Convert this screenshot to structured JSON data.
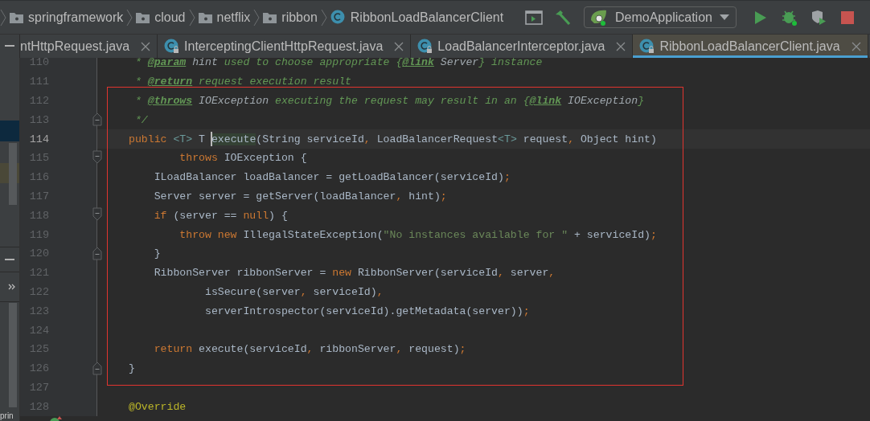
{
  "breadcrumbs": [
    {
      "kind": "folder",
      "label": "springframework"
    },
    {
      "kind": "folder",
      "label": "cloud"
    },
    {
      "kind": "folder",
      "label": "netflix"
    },
    {
      "kind": "folder",
      "label": "ribbon"
    },
    {
      "kind": "class",
      "label": "RibbonLoadBalancerClient"
    }
  ],
  "toolbar": {
    "run_config": "DemoApplication"
  },
  "tabs": [
    {
      "label": "ntHttpRequest.java",
      "selected": false,
      "has_icon": false
    },
    {
      "label": "InterceptingClientHttpRequest.java",
      "selected": false,
      "has_icon": true
    },
    {
      "label": "LoadBalancerInterceptor.java",
      "selected": false,
      "has_icon": true
    },
    {
      "label": "RibbonLoadBalancerClient.java",
      "selected": true,
      "has_icon": true
    }
  ],
  "side_panel": {
    "bottom_text": "prin"
  },
  "editor": {
    "lines": [
      {
        "number": "110",
        "current": false,
        "tokens": [
          {
            "kind": "comment",
            "text": " * "
          },
          {
            "kind": "tag",
            "text": "@param"
          },
          {
            "kind": "ref",
            "text": " hint"
          },
          {
            "kind": "comment",
            "text": " used to choose appropriate {"
          },
          {
            "kind": "tag",
            "text": "@link"
          },
          {
            "kind": "ref",
            "text": " Server"
          },
          {
            "kind": "comment",
            "text": "} instance"
          }
        ]
      },
      {
        "number": "111",
        "current": false,
        "tokens": [
          {
            "kind": "comment",
            "text": " * "
          },
          {
            "kind": "tag",
            "text": "@return"
          },
          {
            "kind": "comment",
            "text": " request execution result"
          }
        ]
      },
      {
        "number": "112",
        "current": false,
        "tokens": [
          {
            "kind": "comment",
            "text": " * "
          },
          {
            "kind": "tag",
            "text": "@throws"
          },
          {
            "kind": "ref",
            "text": " IOException"
          },
          {
            "kind": "comment",
            "text": " executing the request may result in an {"
          },
          {
            "kind": "tag",
            "text": "@link"
          },
          {
            "kind": "ref",
            "text": " IOException"
          },
          {
            "kind": "comment",
            "text": "}"
          }
        ]
      },
      {
        "number": "113",
        "current": false,
        "fold": {
          "kind": "end"
        },
        "tokens": [
          {
            "kind": "comment",
            "text": " */"
          }
        ]
      },
      {
        "number": "114",
        "current": true,
        "tokens": [
          {
            "kind": "keyword",
            "text": "public "
          },
          {
            "kind": "typeparam",
            "text": "<T>"
          },
          {
            "kind": "plain",
            "text": " T "
          },
          {
            "kind": "match",
            "text": "execute"
          },
          {
            "kind": "plain",
            "text": "(String serviceId"
          },
          {
            "kind": "punct",
            "text": ","
          },
          {
            "kind": "plain",
            "text": " LoadBalancerRequest"
          },
          {
            "kind": "typeparam",
            "text": "<T>"
          },
          {
            "kind": "plain",
            "text": " request"
          },
          {
            "kind": "punct",
            "text": ","
          },
          {
            "kind": "plain",
            "text": " Object hint)"
          }
        ]
      },
      {
        "number": "115",
        "current": false,
        "fold": {
          "kind": "start"
        },
        "tokens": [
          {
            "kind": "keyword",
            "text": "        throws"
          },
          {
            "kind": "plain",
            "text": " IOException {"
          }
        ]
      },
      {
        "number": "116",
        "current": false,
        "tokens": [
          {
            "kind": "plain",
            "text": "    ILoadBalancer loadBalancer = getLoadBalancer(serviceId)"
          },
          {
            "kind": "punct",
            "text": ";"
          }
        ]
      },
      {
        "number": "117",
        "current": false,
        "tokens": [
          {
            "kind": "plain",
            "text": "    Server server = getServer(loadBalancer"
          },
          {
            "kind": "punct",
            "text": ","
          },
          {
            "kind": "plain",
            "text": " hint)"
          },
          {
            "kind": "punct",
            "text": ";"
          }
        ]
      },
      {
        "number": "118",
        "current": false,
        "fold": {
          "kind": "start"
        },
        "tokens": [
          {
            "kind": "keyword",
            "text": "    if"
          },
          {
            "kind": "plain",
            "text": " (server == "
          },
          {
            "kind": "keyword",
            "text": "null"
          },
          {
            "kind": "plain",
            "text": ") {"
          }
        ]
      },
      {
        "number": "119",
        "current": false,
        "tokens": [
          {
            "kind": "keyword",
            "text": "        throw new"
          },
          {
            "kind": "plain",
            "text": " IllegalStateException("
          },
          {
            "kind": "string",
            "text": "\"No instances available for \""
          },
          {
            "kind": "plain",
            "text": " + serviceId)"
          },
          {
            "kind": "punct",
            "text": ";"
          }
        ]
      },
      {
        "number": "120",
        "current": false,
        "fold": {
          "kind": "end"
        },
        "tokens": [
          {
            "kind": "plain",
            "text": "    }"
          }
        ]
      },
      {
        "number": "121",
        "current": false,
        "tokens": [
          {
            "kind": "plain",
            "text": "    RibbonServer ribbonServer = "
          },
          {
            "kind": "keyword",
            "text": "new"
          },
          {
            "kind": "plain",
            "text": " RibbonServer(serviceId"
          },
          {
            "kind": "punct",
            "text": ","
          },
          {
            "kind": "plain",
            "text": " server"
          },
          {
            "kind": "punct",
            "text": ","
          }
        ]
      },
      {
        "number": "122",
        "current": false,
        "tokens": [
          {
            "kind": "plain",
            "text": "            isSecure(server"
          },
          {
            "kind": "punct",
            "text": ","
          },
          {
            "kind": "plain",
            "text": " serviceId)"
          },
          {
            "kind": "punct",
            "text": ","
          }
        ]
      },
      {
        "number": "123",
        "current": false,
        "tokens": [
          {
            "kind": "plain",
            "text": "            serverIntrospector(serviceId).getMetadata(server))"
          },
          {
            "kind": "punct",
            "text": ";"
          }
        ]
      },
      {
        "number": "124",
        "current": false
      },
      {
        "number": "125",
        "current": false,
        "tokens": [
          {
            "kind": "keyword",
            "text": "    return"
          },
          {
            "kind": "plain",
            "text": " execute(serviceId"
          },
          {
            "kind": "punct",
            "text": ","
          },
          {
            "kind": "plain",
            "text": " ribbonServer"
          },
          {
            "kind": "punct",
            "text": ","
          },
          {
            "kind": "plain",
            "text": " request)"
          },
          {
            "kind": "punct",
            "text": ";"
          }
        ]
      },
      {
        "number": "126",
        "current": false,
        "fold": {
          "kind": "end"
        },
        "tokens": [
          {
            "kind": "plain",
            "text": "}"
          }
        ]
      },
      {
        "number": "127",
        "current": false
      },
      {
        "number": "128",
        "current": false,
        "tokens": [
          {
            "kind": "annotation",
            "text": "@Override"
          }
        ]
      }
    ]
  }
}
